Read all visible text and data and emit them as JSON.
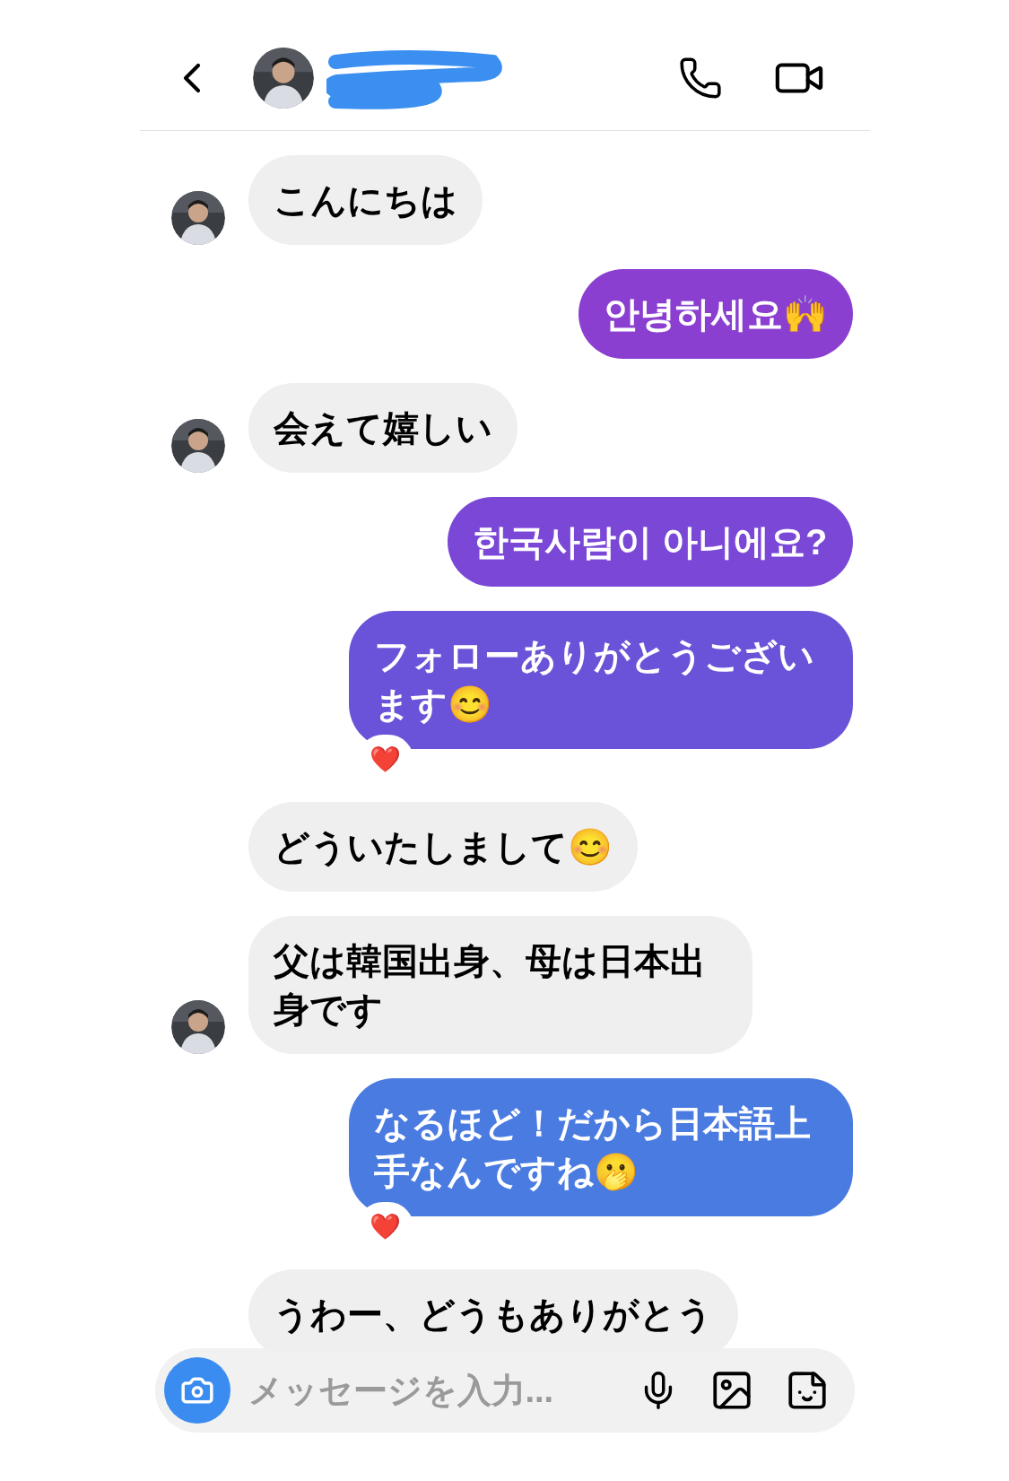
{
  "messages": [
    {
      "kind": "received",
      "text": "こんにちは",
      "show_avatar": true
    },
    {
      "kind": "sent",
      "text": "안녕하세요🙌",
      "color": "#8b3fd0"
    },
    {
      "kind": "received",
      "text": "会えて嬉しい",
      "show_avatar": true
    },
    {
      "kind": "sent",
      "text": "한국사람이 아니에요?",
      "color": "#7a47d6"
    },
    {
      "kind": "sent",
      "text": "フォローありがとうございます😊",
      "color": "#6a53d8",
      "reaction": "❤️"
    },
    {
      "kind": "received",
      "text": "どういたしまして😊",
      "show_avatar": false
    },
    {
      "kind": "received",
      "text": "父は韓国出身、母は日本出身です",
      "show_avatar": true
    },
    {
      "kind": "sent",
      "text": "なるほど！だから日本語上手なんですね🫢",
      "color": "#4a7be1",
      "reaction": "❤️"
    },
    {
      "kind": "received",
      "text": "うわー、どうもありがとう",
      "show_avatar": false
    }
  ],
  "composer": {
    "placeholder": "メッセージを入力..."
  }
}
